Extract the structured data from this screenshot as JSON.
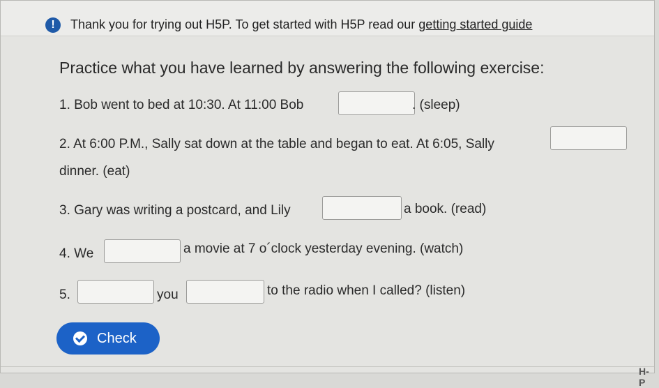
{
  "notice": {
    "icon": "info-icon",
    "icon_glyph": "!",
    "text": "Thank you for trying out H5P. To get started with H5P read our",
    "link": "getting started guide"
  },
  "exercise": {
    "title": "Practice what you have learned by answering the following exercise:",
    "q1": {
      "before": "1. Bob went to bed at 10:30. At 11:00 Bob",
      "after": ". (sleep)",
      "value": ""
    },
    "q2": {
      "before": "2. At 6:00 P.M., Sally sat down at the table and began to eat. At 6:05, Sally",
      "after": "dinner. (eat)",
      "value": ""
    },
    "q3": {
      "before": "3. Gary was writing a postcard, and Lily",
      "after": "a book. (read)",
      "value": ""
    },
    "q4": {
      "before": "4. We",
      "after": "a movie at 7 o´clock yesterday evening. (watch)",
      "value": ""
    },
    "q5": {
      "before": "5.",
      "middle": "you",
      "after": "to the radio when I called? (listen)",
      "value1": "",
      "value2": ""
    }
  },
  "check_button": {
    "label": "Check",
    "icon": "check-circle-icon",
    "color": "#1c62c7"
  },
  "footer": {
    "logo": "H-P"
  }
}
